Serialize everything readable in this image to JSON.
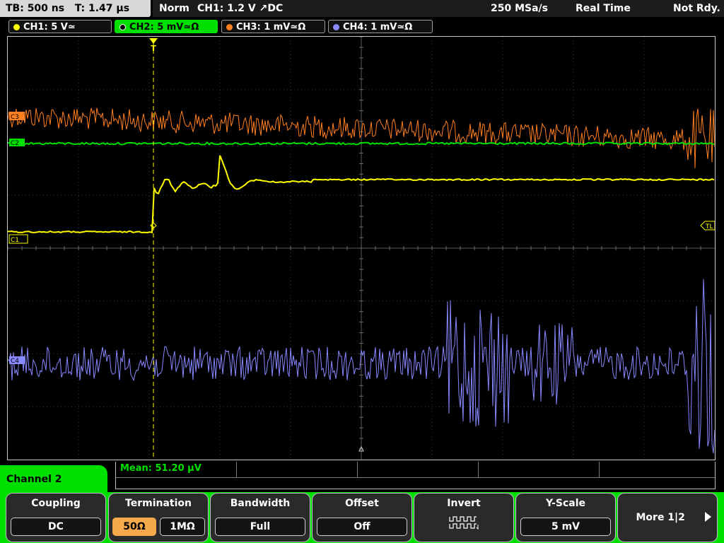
{
  "topbar": {
    "timebase": "TB: 500 ns",
    "trigger_pos": "T: 1.47 µs",
    "mode": "Norm",
    "trigger": "CH1: 1.2 V ↗DC",
    "sample_rate": "250 MSa/s",
    "acq_mode": "Real Time",
    "ready": "Not Rdy."
  },
  "channels": [
    {
      "label": "CH1: 5 V≃",
      "color": "#ffff00"
    },
    {
      "label": "CH2: 5 mV≃Ω",
      "color": "#00e000"
    },
    {
      "label": "CH3: 1 mV≃Ω",
      "color": "#ff8020"
    },
    {
      "label": "CH4: 1 mV≃Ω",
      "color": "#8888ff"
    }
  ],
  "markers": {
    "ch3": "C3",
    "ch2": "C2",
    "ch1": "C1",
    "ch4": "C4",
    "trigger_level": "TL",
    "trigger_icon": "T"
  },
  "measurement": {
    "label": "Mean: 51.20 µV"
  },
  "panel_label": "Channel 2",
  "softkeys": {
    "coupling": {
      "title": "Coupling",
      "value": "DC"
    },
    "termination": {
      "title": "Termination",
      "opt1": "50Ω",
      "opt2": "1MΩ",
      "selected": "50Ω"
    },
    "bandwidth": {
      "title": "Bandwidth",
      "value": "Full"
    },
    "offset": {
      "title": "Offset",
      "value": "Off"
    },
    "invert": {
      "title": "Invert",
      "icon": "inverted-square-wave-icon"
    },
    "yscale": {
      "title": "Y-Scale",
      "value": "5 mV"
    },
    "more": {
      "title": "More 1|2"
    }
  },
  "trace_colors": {
    "ch1": "#ffff00",
    "ch2": "#00e000",
    "ch3": "#ff8020",
    "ch4": "#8888ff"
  }
}
